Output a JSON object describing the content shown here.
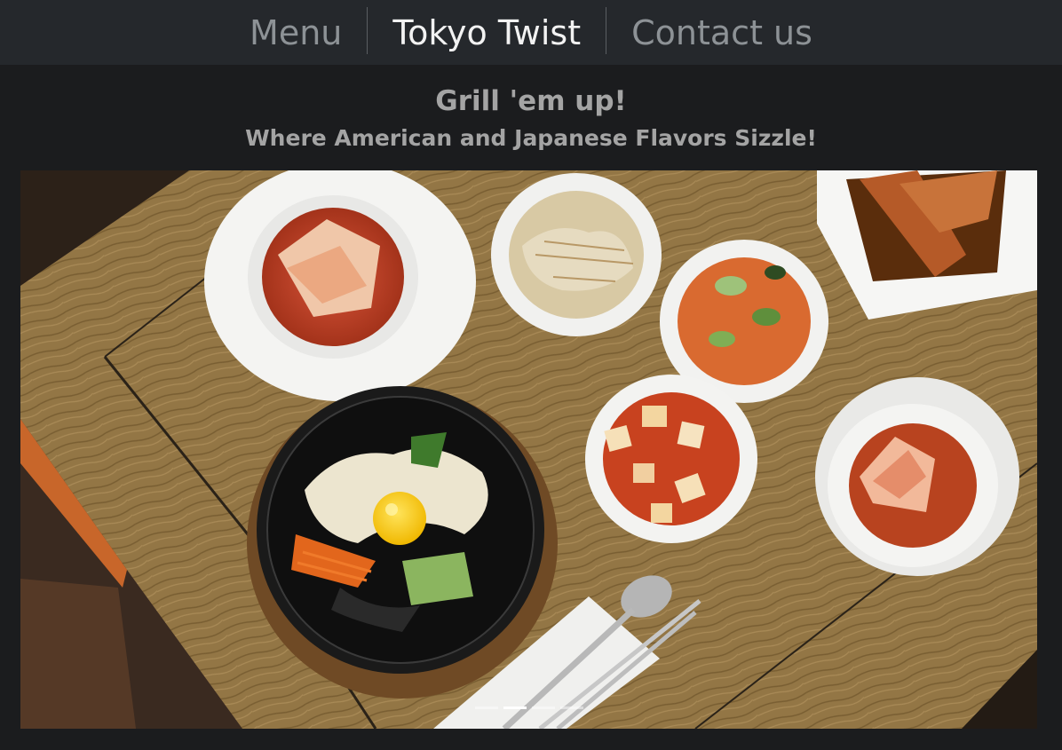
{
  "nav": {
    "items": [
      {
        "label": "Menu",
        "brand": false
      },
      {
        "label": "Tokyo Twist",
        "brand": true
      },
      {
        "label": "Contact us",
        "brand": false
      }
    ]
  },
  "hero": {
    "title": "Grill 'em up!",
    "subtitle": "Where American and Japanese Flavors Sizzle!"
  },
  "carousel": {
    "slide_count": 4,
    "active_slide": 2,
    "image_subject": "overhead-korean-bibimbap-table-photo"
  },
  "colors": {
    "nav_bg": "#25282c",
    "page_bg": "#1b1c1e",
    "brand_text": "#f2f2f2",
    "nav_text": "#8d9296",
    "hero_text": "#a4a4a4"
  }
}
